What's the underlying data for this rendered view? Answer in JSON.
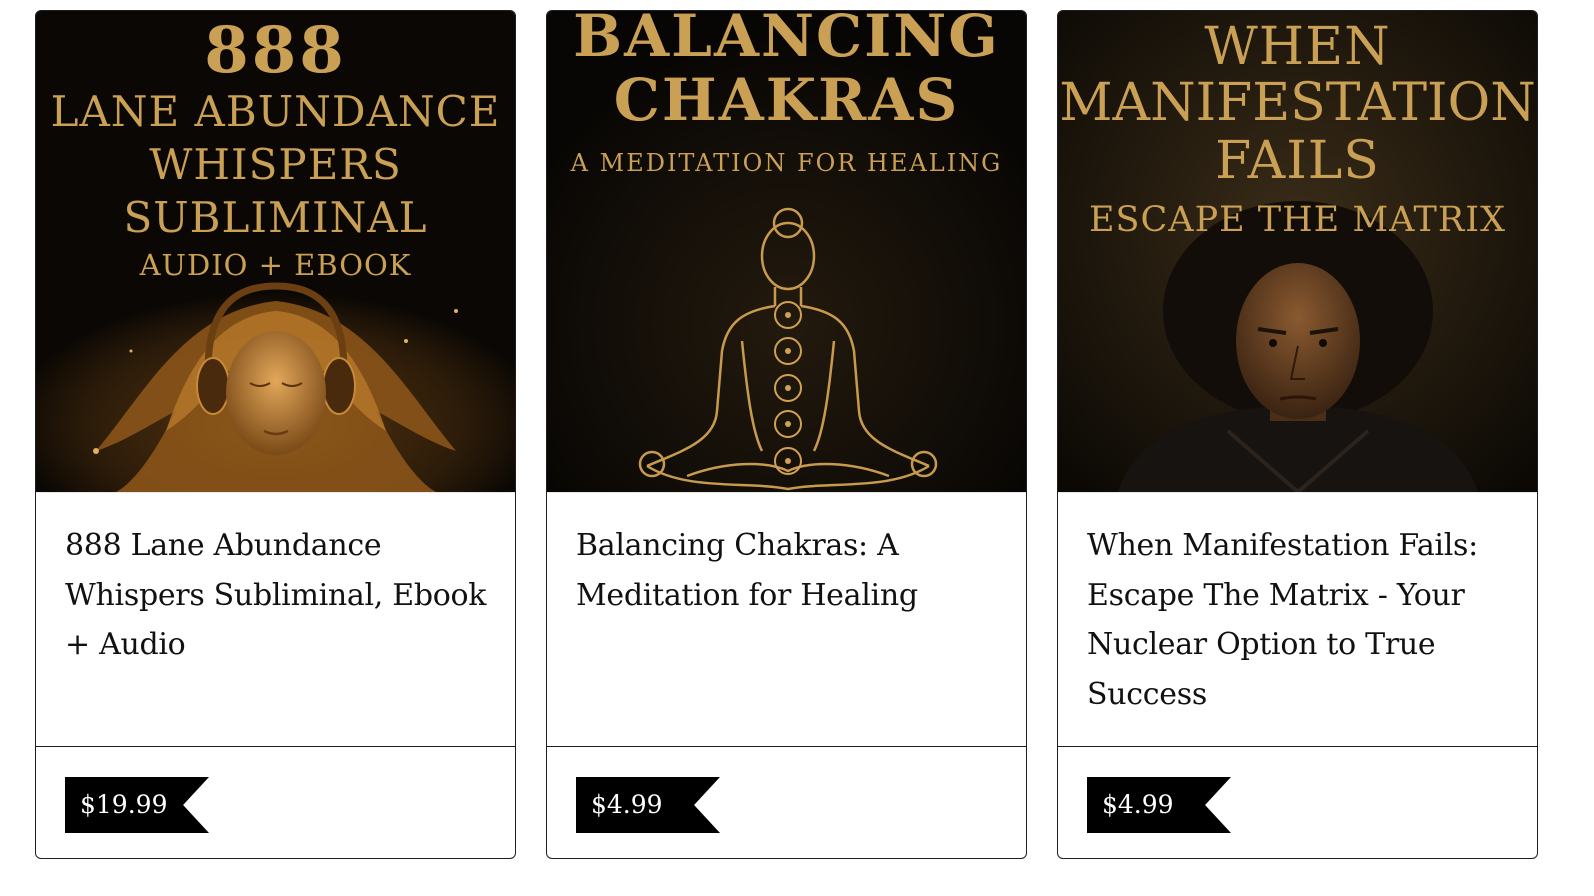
{
  "products": [
    {
      "cover": {
        "lines": [
          "888",
          "Lane Abundance",
          "Whispers",
          "Subliminal",
          "Audio + Ebook"
        ],
        "icon": "woman-with-headphones-illustration"
      },
      "title": "888 Lane Abundance Whispers Subliminal, Ebook + Audio",
      "price": "$19.99"
    },
    {
      "cover": {
        "lines": [
          "Balancing",
          "Chakras",
          "A Meditation for Healing"
        ],
        "icon": "meditating-figure-chakras-illustration"
      },
      "title": "Balancing Chakras: A Meditation for Healing",
      "price": "$4.99"
    },
    {
      "cover": {
        "lines": [
          "When",
          "Manifestation",
          "Fails",
          "Escape the Matrix"
        ],
        "icon": "man-portrait-illustration"
      },
      "title": "When Manifestation Fails: Escape The Matrix - Your Nuclear Option to True Success",
      "price": "$4.99"
    }
  ],
  "colors": {
    "cover_background": "#0b0906",
    "cover_gold": "#caa055",
    "price_tag_background": "#000000",
    "card_border": "#1e1e1e"
  }
}
